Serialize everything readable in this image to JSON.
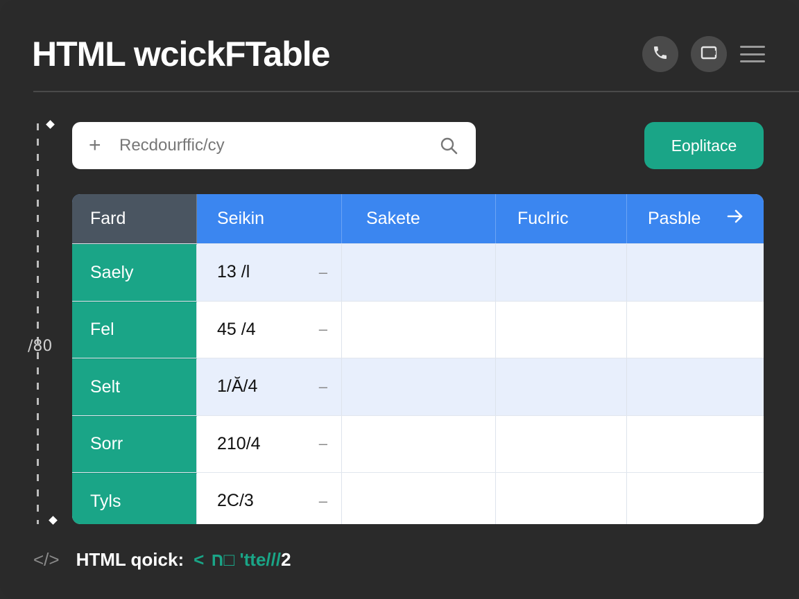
{
  "app": {
    "title": "HTML wcickFTable"
  },
  "toolbar": {
    "phone_icon": "phone-icon",
    "window_icon": "window-icon",
    "menu_icon": "menu-icon"
  },
  "ruler": {
    "label": "/80"
  },
  "search": {
    "placeholder": "Recdourffic/cy",
    "icon": "search-icon"
  },
  "action": {
    "label": "Eoplitace"
  },
  "table": {
    "columns": [
      "Fard",
      "Seikin",
      "Sakete",
      "Fuclric",
      "Pasble"
    ],
    "rows": [
      {
        "label": "Saely",
        "value": "13 /l",
        "marker": "–"
      },
      {
        "label": "Fel",
        "value": "45 /4",
        "marker": "–"
      },
      {
        "label": "Selt",
        "value": "1/Ă/4",
        "marker": "–"
      },
      {
        "label": "Sorr",
        "value": "210/4",
        "marker": "–"
      },
      {
        "label": "Tyls",
        "value": "2C/3",
        "marker": "–"
      }
    ]
  },
  "footer": {
    "label": "HTML qoick:",
    "chevron": "<",
    "link": "ח□ 'tte///",
    "number": "2"
  },
  "colors": {
    "accent_green": "#1aa587",
    "header_blue": "#3b86f0",
    "background": "#2a2a2a"
  }
}
